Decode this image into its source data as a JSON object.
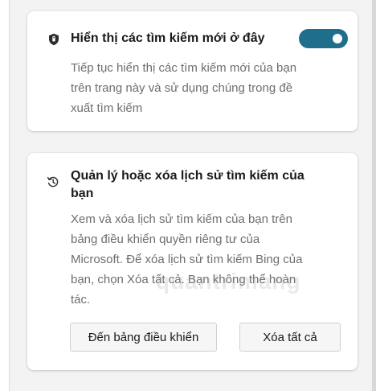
{
  "show_new_searches": {
    "title": "Hiển thị các tìm kiếm mới ở đây",
    "description_lines": [
      "Tiếp tục hiển thị các tìm kiếm mới của bạn",
      "trên trang này và sử dụng chúng trong đề",
      "xuất tìm kiếm"
    ],
    "toggle_on": true,
    "icon": "shield-icon"
  },
  "manage_history": {
    "title_lines": [
      "Quản lý hoặc xóa lịch sử tìm kiếm của",
      "bạn"
    ],
    "description_lines": [
      "Xem và xóa lịch sử tìm kiếm của bạn trên",
      "bảng điều khiển quyền riêng tư của",
      "Microsoft. Để xóa lịch sử tìm kiếm Bing của",
      "bạn, chọn Xóa tất cả. Bạn không thể hoàn",
      "tác."
    ],
    "icon": "history-icon",
    "buttons": {
      "dashboard_label": "Đến bảng điều khiển",
      "clear_all_label": "Xóa tất cả"
    }
  },
  "watermark": "quantrimang",
  "colors": {
    "toggle_on": "#1f6e8c",
    "description_text": "#6e6e6e"
  }
}
